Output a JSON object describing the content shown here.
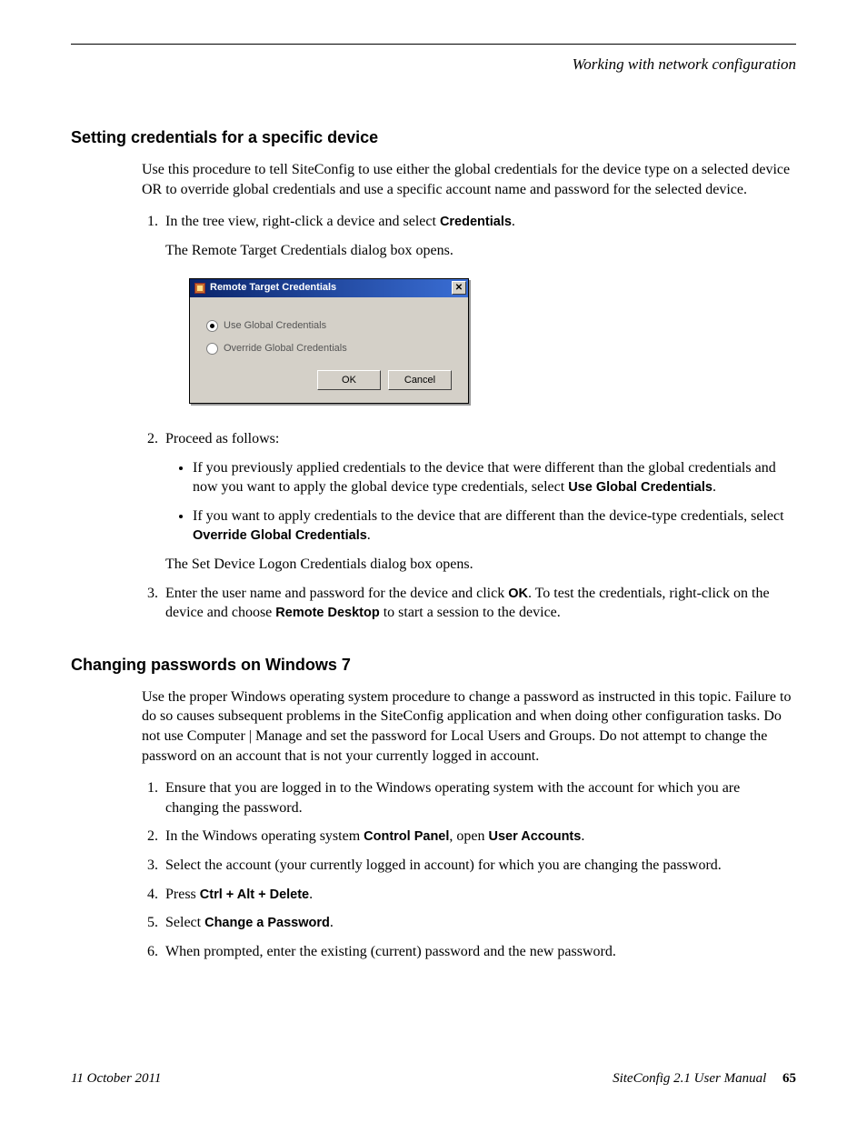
{
  "header": {
    "running_head": "Working with network configuration"
  },
  "section1": {
    "title": "Setting credentials for a specific device",
    "intro": "Use this procedure to tell SiteConfig to use either the global credentials for the device type on a selected device OR to override global credentials and use a specific account name and password for the selected device.",
    "step1_a": "In the tree view, right-click a device and select ",
    "step1_bold": "Credentials",
    "step1_b": ".",
    "step1_result": "The Remote Target Credentials dialog box opens.",
    "step2_lead": "Proceed as follows:",
    "step2_b1_a": "If you previously applied credentials to the device that were different than the global credentials and now you want to apply the global device type credentials, select ",
    "step2_b1_bold": "Use Global Credentials",
    "step2_b1_b": ".",
    "step2_b2_a": "If you want to apply credentials to the device that are different than the device-type credentials, select ",
    "step2_b2_bold": "Override Global Credentials",
    "step2_b2_b": ".",
    "step2_result": "The Set Device Logon Credentials dialog box opens.",
    "step3_a": "Enter the user name and password for the device and click ",
    "step3_bold1": "OK",
    "step3_b": ". To test the credentials, right-click on the device and choose ",
    "step3_bold2": "Remote Desktop",
    "step3_c": " to start a session to the device."
  },
  "dialog": {
    "title": "Remote Target Credentials",
    "radio1": "Use Global Credentials",
    "radio2": "Override Global Credentials",
    "ok": "OK",
    "cancel": "Cancel"
  },
  "section2": {
    "title": "Changing passwords on Windows 7",
    "intro": "Use the proper Windows operating system procedure to change a password as instructed in this topic. Failure to do so causes subsequent problems in the SiteConfig application and when doing other configuration tasks. Do not use Computer | Manage and set the password for Local Users and Groups. Do not attempt to change the password on an account that is not your currently logged in account.",
    "s1": "Ensure that you are logged in to the Windows operating system with the account for which you are changing the password.",
    "s2_a": "In the Windows operating system ",
    "s2_bold1": "Control Panel",
    "s2_b": ", open ",
    "s2_bold2": "User Accounts",
    "s2_c": ".",
    "s3": "Select the account (your currently logged in account) for which you are changing the password.",
    "s4_a": "Press ",
    "s4_bold": "Ctrl + Alt + Delete",
    "s4_b": ".",
    "s5_a": "Select ",
    "s5_bold": "Change a Password",
    "s5_b": ".",
    "s6": "When prompted, enter the existing (current) password and the new password."
  },
  "footer": {
    "date": "11 October 2011",
    "product": "SiteConfig",
    "version": "2.1",
    "manual": "User Manual",
    "page": "65"
  }
}
